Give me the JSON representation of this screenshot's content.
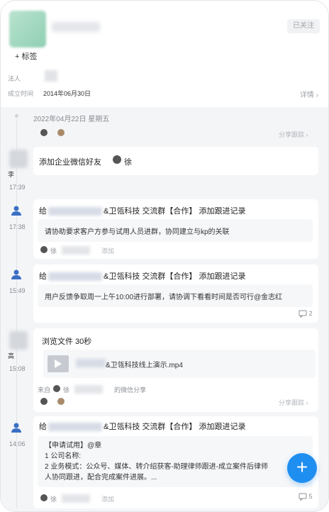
{
  "header": {
    "follow_label": "已关注",
    "tag_label": "+ 标签",
    "legal_label": "法人",
    "established_label": "成立时间",
    "established_date": "2014年06月30日",
    "detail_label": "详情 ›"
  },
  "timeline": {
    "date_heading": "2022年04月22日 星期五",
    "share_label": "分享跟踪 ›",
    "entries": [
      {
        "time": "",
        "share": "分享跟踪 ›"
      },
      {
        "time": "17:39",
        "user": "李",
        "title": "添加企业微信好友",
        "mention": "徐"
      },
      {
        "time": "17:38",
        "title_prefix": "给",
        "title_suffix": "&卫瓴科技 交流群【合作】 添加跟进记录",
        "content": "请协助要求客户方参与试用人员进群，协同建立与kp的关联",
        "author": "徐",
        "action": "添加"
      },
      {
        "time": "15:49",
        "title_prefix": "给",
        "title_suffix": "&卫瓴科技 交流群【合作】 添加跟进记录",
        "content": "用户反馈争取周一上午10:00进行部署，请协调下看看时间是否可行@金志红",
        "comment_count": "2"
      },
      {
        "time": "15:08",
        "user": "高",
        "title": "浏览文件 30秒",
        "file_name": "&卫瓴科技线上演示.mp4",
        "source_prefix": "来自",
        "source_name": "徐",
        "source_suffix": "的微信分享",
        "share": "分享跟踪 ›"
      },
      {
        "time": "14:06",
        "title_prefix": "给",
        "title_suffix": "&卫瓴科技 交流群【合作】 添加跟进记录",
        "content_line1": "【申请试用】@章",
        "content_line2": "1 公司名称:",
        "content_line3": "2 业务模式：公众号、媒体、转介绍获客-助理律师跟进-成立案件后律师",
        "content_line4": "人协同跟进，配合完成案件进展。...",
        "author": "徐",
        "action": "添加",
        "comment_count": "5"
      }
    ]
  },
  "fab": {
    "label": "+"
  },
  "colors": {
    "accent": "#1f8ef1",
    "background": "#f4f5f7"
  }
}
